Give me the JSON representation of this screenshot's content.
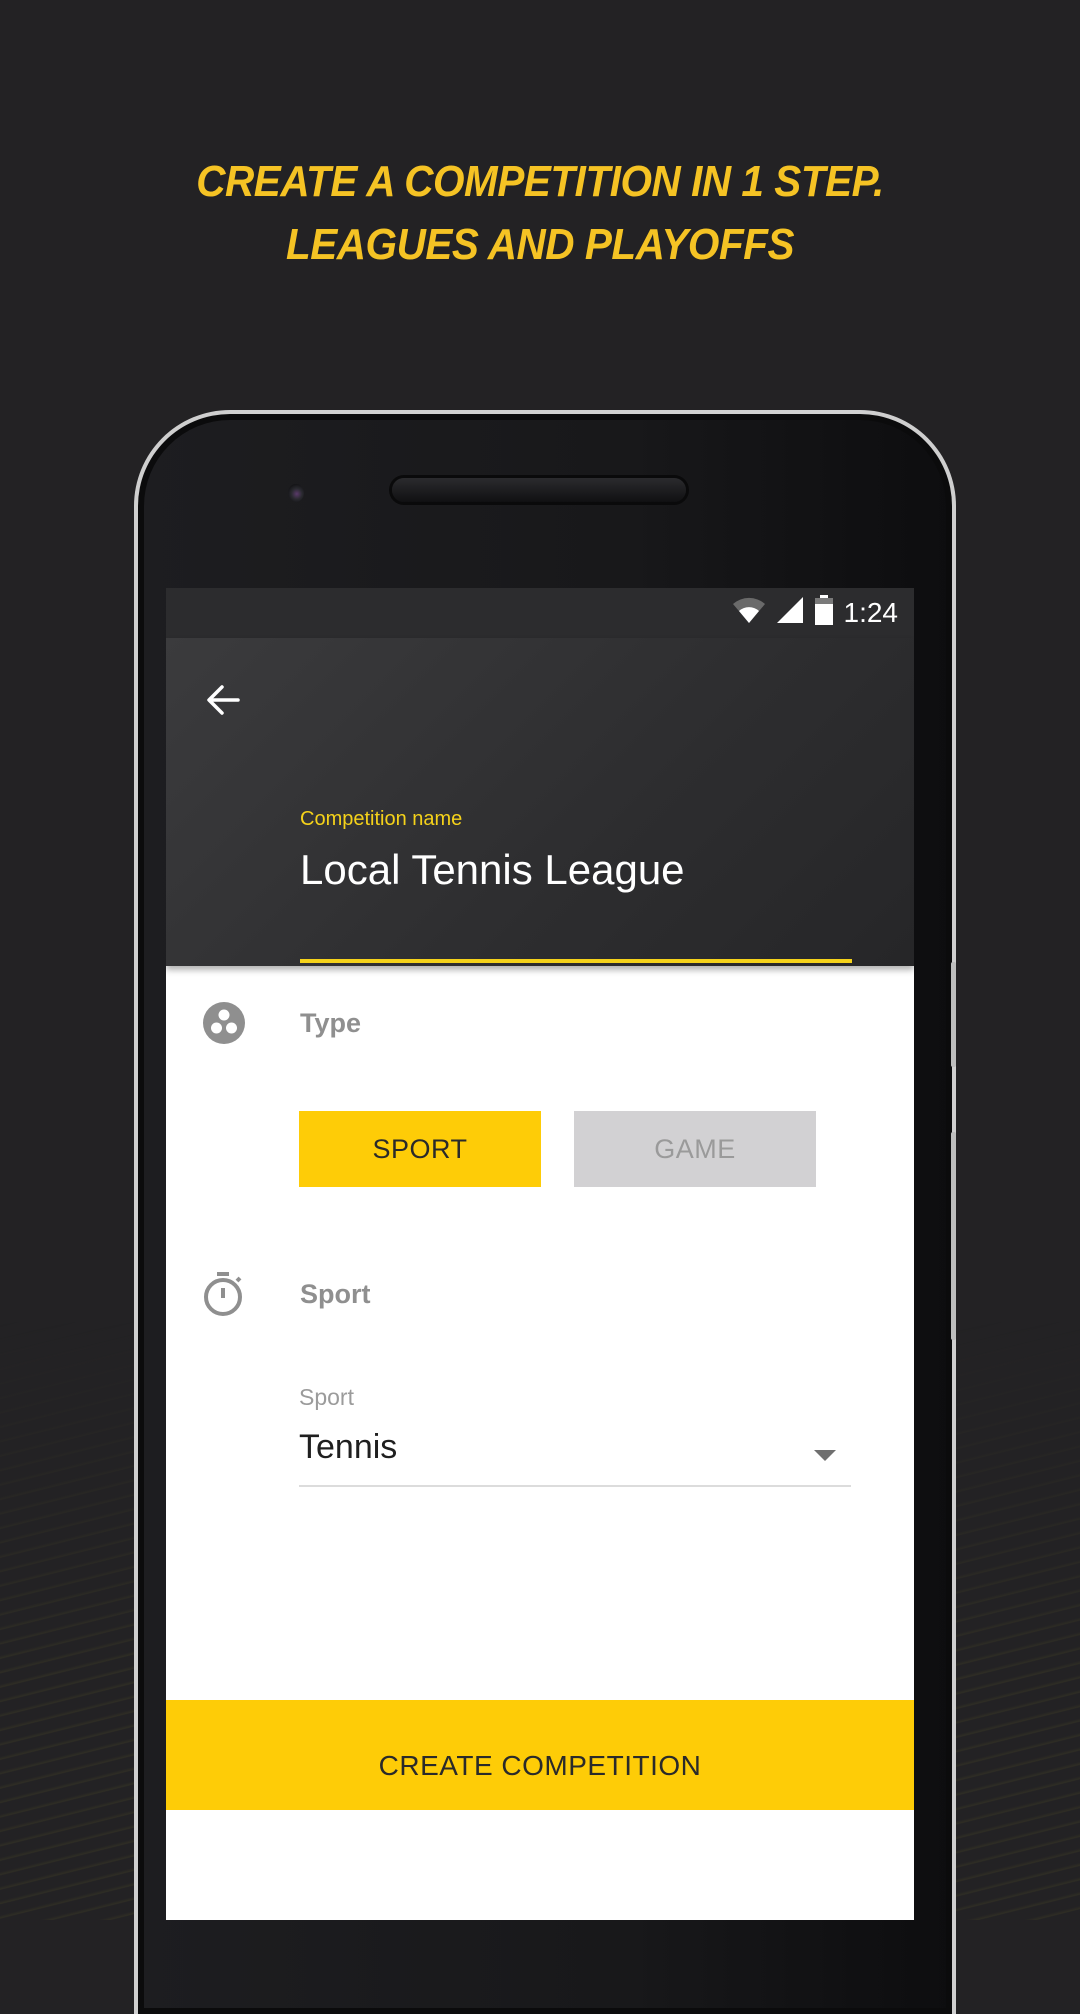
{
  "promo": {
    "headline_line1": "CREATE A COMPETITION IN  1 STEP.",
    "headline_line2": "LEAGUES AND PLAYOFFS"
  },
  "statusbar": {
    "time": "1:24",
    "icons": [
      "wifi-icon",
      "cellular-signal-icon",
      "battery-icon"
    ]
  },
  "appbar": {
    "back_icon": "arrow-left-icon",
    "competition_name_label": "Competition name",
    "competition_name_value": "Local Tennis League"
  },
  "type_section": {
    "icon": "three-circles-icon",
    "title": "Type",
    "options": [
      {
        "label": "SPORT",
        "selected": true
      },
      {
        "label": "GAME",
        "selected": false
      }
    ]
  },
  "sport_section": {
    "icon": "stopwatch-icon",
    "title": "Sport",
    "select_label": "Sport",
    "select_value": "Tennis"
  },
  "actions": {
    "create_label": "CREATE COMPETITION"
  },
  "colors": {
    "accent": "#fecc07",
    "headline": "#f5c324",
    "appbar": "#2d2d2f"
  }
}
